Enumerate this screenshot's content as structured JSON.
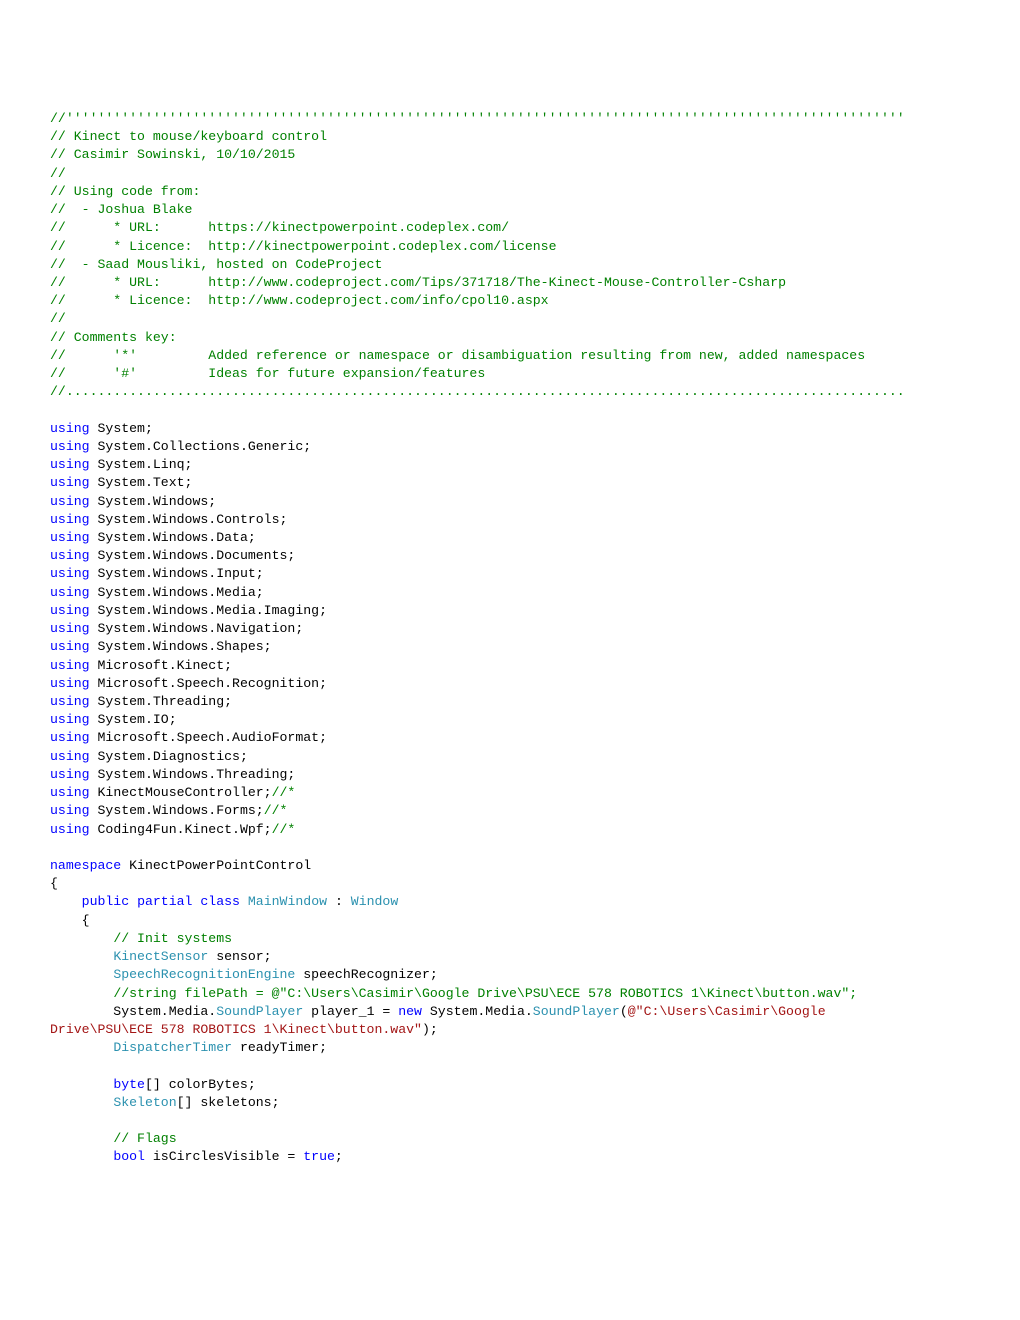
{
  "lines": [
    [
      {
        "cls": "c-comment",
        "t": "//''''''''''''''''''''''''''''''''''''''''''''''''''''''''''''''''''''''''''''''''''''''''''''''''''''''''''"
      }
    ],
    [
      {
        "cls": "c-comment",
        "t": "// Kinect to mouse/keyboard control"
      }
    ],
    [
      {
        "cls": "c-comment",
        "t": "// Casimir Sowinski, 10/10/2015"
      }
    ],
    [
      {
        "cls": "c-comment",
        "t": "//"
      }
    ],
    [
      {
        "cls": "c-comment",
        "t": "// Using code from:"
      }
    ],
    [
      {
        "cls": "c-comment",
        "t": "//  - Joshua Blake"
      }
    ],
    [
      {
        "cls": "c-comment",
        "t": "//      * URL:      https://kinectpowerpoint.codeplex.com/"
      }
    ],
    [
      {
        "cls": "c-comment",
        "t": "//      * Licence:  http://kinectpowerpoint.codeplex.com/license"
      }
    ],
    [
      {
        "cls": "c-comment",
        "t": "//  - Saad Mousliki, hosted on CodeProject"
      }
    ],
    [
      {
        "cls": "c-comment",
        "t": "//      * URL:      http://www.codeproject.com/Tips/371718/The-Kinect-Mouse-Controller-Csharp"
      }
    ],
    [
      {
        "cls": "c-comment",
        "t": "//      * Licence:  http://www.codeproject.com/info/cpol10.aspx"
      }
    ],
    [
      {
        "cls": "c-comment",
        "t": "//"
      }
    ],
    [
      {
        "cls": "c-comment",
        "t": "// Comments key:"
      }
    ],
    [
      {
        "cls": "c-comment",
        "t": "//      '*'         Added reference or namespace or disambiguation resulting from new, added namespaces"
      }
    ],
    [
      {
        "cls": "c-comment",
        "t": "//      '#'         Ideas for future expansion/features"
      }
    ],
    [
      {
        "cls": "c-comment",
        "t": "//.........................................................................................................."
      }
    ],
    [
      {
        "cls": "c-plain",
        "t": ""
      }
    ],
    [
      {
        "cls": "c-keyword",
        "t": "using"
      },
      {
        "cls": "c-plain",
        "t": " System;"
      }
    ],
    [
      {
        "cls": "c-keyword",
        "t": "using"
      },
      {
        "cls": "c-plain",
        "t": " System.Collections.Generic;"
      }
    ],
    [
      {
        "cls": "c-keyword",
        "t": "using"
      },
      {
        "cls": "c-plain",
        "t": " System.Linq;"
      }
    ],
    [
      {
        "cls": "c-keyword",
        "t": "using"
      },
      {
        "cls": "c-plain",
        "t": " System.Text;"
      }
    ],
    [
      {
        "cls": "c-keyword",
        "t": "using"
      },
      {
        "cls": "c-plain",
        "t": " System.Windows;"
      }
    ],
    [
      {
        "cls": "c-keyword",
        "t": "using"
      },
      {
        "cls": "c-plain",
        "t": " System.Windows.Controls;"
      }
    ],
    [
      {
        "cls": "c-keyword",
        "t": "using"
      },
      {
        "cls": "c-plain",
        "t": " System.Windows.Data;"
      }
    ],
    [
      {
        "cls": "c-keyword",
        "t": "using"
      },
      {
        "cls": "c-plain",
        "t": " System.Windows.Documents;"
      }
    ],
    [
      {
        "cls": "c-keyword",
        "t": "using"
      },
      {
        "cls": "c-plain",
        "t": " System.Windows.Input;"
      }
    ],
    [
      {
        "cls": "c-keyword",
        "t": "using"
      },
      {
        "cls": "c-plain",
        "t": " System.Windows.Media;"
      }
    ],
    [
      {
        "cls": "c-keyword",
        "t": "using"
      },
      {
        "cls": "c-plain",
        "t": " System.Windows.Media.Imaging;"
      }
    ],
    [
      {
        "cls": "c-keyword",
        "t": "using"
      },
      {
        "cls": "c-plain",
        "t": " System.Windows.Navigation;"
      }
    ],
    [
      {
        "cls": "c-keyword",
        "t": "using"
      },
      {
        "cls": "c-plain",
        "t": " System.Windows.Shapes;"
      }
    ],
    [
      {
        "cls": "c-keyword",
        "t": "using"
      },
      {
        "cls": "c-plain",
        "t": " Microsoft.Kinect;"
      }
    ],
    [
      {
        "cls": "c-keyword",
        "t": "using"
      },
      {
        "cls": "c-plain",
        "t": " Microsoft.Speech.Recognition;"
      }
    ],
    [
      {
        "cls": "c-keyword",
        "t": "using"
      },
      {
        "cls": "c-plain",
        "t": " System.Threading;"
      }
    ],
    [
      {
        "cls": "c-keyword",
        "t": "using"
      },
      {
        "cls": "c-plain",
        "t": " System.IO;"
      }
    ],
    [
      {
        "cls": "c-keyword",
        "t": "using"
      },
      {
        "cls": "c-plain",
        "t": " Microsoft.Speech.AudioFormat;"
      }
    ],
    [
      {
        "cls": "c-keyword",
        "t": "using"
      },
      {
        "cls": "c-plain",
        "t": " System.Diagnostics;"
      }
    ],
    [
      {
        "cls": "c-keyword",
        "t": "using"
      },
      {
        "cls": "c-plain",
        "t": " System.Windows.Threading;"
      }
    ],
    [
      {
        "cls": "c-keyword",
        "t": "using"
      },
      {
        "cls": "c-plain",
        "t": " KinectMouseController;"
      },
      {
        "cls": "c-comment",
        "t": "//*"
      }
    ],
    [
      {
        "cls": "c-keyword",
        "t": "using"
      },
      {
        "cls": "c-plain",
        "t": " System.Windows.Forms;"
      },
      {
        "cls": "c-comment",
        "t": "//*"
      }
    ],
    [
      {
        "cls": "c-keyword",
        "t": "using"
      },
      {
        "cls": "c-plain",
        "t": " Coding4Fun.Kinect.Wpf;"
      },
      {
        "cls": "c-comment",
        "t": "//*"
      }
    ],
    [
      {
        "cls": "c-plain",
        "t": ""
      }
    ],
    [
      {
        "cls": "c-keyword",
        "t": "namespace"
      },
      {
        "cls": "c-plain",
        "t": " KinectPowerPointControl"
      }
    ],
    [
      {
        "cls": "c-plain",
        "t": "{"
      }
    ],
    [
      {
        "cls": "c-plain",
        "t": "    "
      },
      {
        "cls": "c-keyword",
        "t": "public"
      },
      {
        "cls": "c-plain",
        "t": " "
      },
      {
        "cls": "c-keyword",
        "t": "partial"
      },
      {
        "cls": "c-plain",
        "t": " "
      },
      {
        "cls": "c-keyword",
        "t": "class"
      },
      {
        "cls": "c-plain",
        "t": " "
      },
      {
        "cls": "c-type",
        "t": "MainWindow"
      },
      {
        "cls": "c-plain",
        "t": " : "
      },
      {
        "cls": "c-type",
        "t": "Window"
      }
    ],
    [
      {
        "cls": "c-plain",
        "t": "    {"
      }
    ],
    [
      {
        "cls": "c-plain",
        "t": "        "
      },
      {
        "cls": "c-comment",
        "t": "// Init systems"
      }
    ],
    [
      {
        "cls": "c-plain",
        "t": "        "
      },
      {
        "cls": "c-type",
        "t": "KinectSensor"
      },
      {
        "cls": "c-plain",
        "t": " sensor;"
      }
    ],
    [
      {
        "cls": "c-plain",
        "t": "        "
      },
      {
        "cls": "c-type",
        "t": "SpeechRecognitionEngine"
      },
      {
        "cls": "c-plain",
        "t": " speechRecognizer;"
      }
    ],
    [
      {
        "cls": "c-plain",
        "t": "        "
      },
      {
        "cls": "c-comment",
        "t": "//string filePath = @\"C:\\Users\\Casimir\\Google Drive\\PSU\\ECE 578 ROBOTICS 1\\Kinect\\button.wav\";"
      }
    ],
    [
      {
        "cls": "c-plain",
        "t": "        System.Media."
      },
      {
        "cls": "c-type",
        "t": "SoundPlayer"
      },
      {
        "cls": "c-plain",
        "t": " player_1 = "
      },
      {
        "cls": "c-keyword",
        "t": "new"
      },
      {
        "cls": "c-plain",
        "t": " System.Media."
      },
      {
        "cls": "c-type",
        "t": "SoundPlayer"
      },
      {
        "cls": "c-plain",
        "t": "("
      },
      {
        "cls": "c-string",
        "t": "@\"C:\\Users\\Casimir\\Google \nDrive\\PSU\\ECE 578 ROBOTICS 1\\Kinect\\button.wav\""
      },
      {
        "cls": "c-plain",
        "t": ");"
      }
    ],
    [
      {
        "cls": "c-plain",
        "t": "        "
      },
      {
        "cls": "c-type",
        "t": "DispatcherTimer"
      },
      {
        "cls": "c-plain",
        "t": " readyTimer;"
      }
    ],
    [
      {
        "cls": "c-plain",
        "t": ""
      }
    ],
    [
      {
        "cls": "c-plain",
        "t": "        "
      },
      {
        "cls": "c-keyword",
        "t": "byte"
      },
      {
        "cls": "c-plain",
        "t": "[] colorBytes;"
      }
    ],
    [
      {
        "cls": "c-plain",
        "t": "        "
      },
      {
        "cls": "c-type",
        "t": "Skeleton"
      },
      {
        "cls": "c-plain",
        "t": "[] skeletons;"
      }
    ],
    [
      {
        "cls": "c-plain",
        "t": ""
      }
    ],
    [
      {
        "cls": "c-plain",
        "t": "        "
      },
      {
        "cls": "c-comment",
        "t": "// Flags"
      }
    ],
    [
      {
        "cls": "c-plain",
        "t": "        "
      },
      {
        "cls": "c-keyword",
        "t": "bool"
      },
      {
        "cls": "c-plain",
        "t": " isCirclesVisible = "
      },
      {
        "cls": "c-keyword",
        "t": "true"
      },
      {
        "cls": "c-plain",
        "t": ";"
      }
    ]
  ]
}
